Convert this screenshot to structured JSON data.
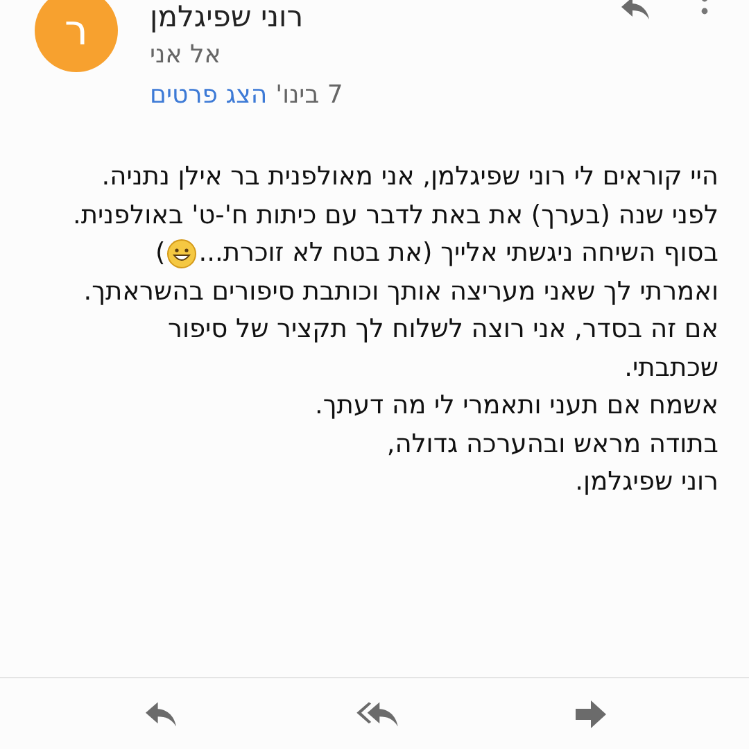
{
  "sender": {
    "avatar_letter": "ר",
    "name": "רוני שפיגלמן",
    "to": "אל אני",
    "date": "7 בינו'",
    "details_link": "הצג פרטים"
  },
  "body": [
    {
      "text": "היי קוראים לי רוני שפיגלמן, אני מאולפנית בר אילן נתניה."
    },
    {
      "text": "לפני שנה (בערך) את באת לדבר עם כיתות ח'-ט' באולפנית."
    },
    {
      "text": "בסוף השיחה ניגשתי אלייך (את בטח לא זוכרת...",
      "emoji": true,
      "tail": ")"
    },
    {
      "text": "ואמרתי לך שאני מעריצה אותך וכותבת סיפורים בהשראתך."
    },
    {
      "text": "אם זה בסדר, אני רוצה לשלוח לך תקציר של סיפור"
    },
    {
      "text": "שכתבתי."
    },
    {
      "text": "אשמח אם תעני ותאמרי לי מה דעתך."
    },
    {
      "text": "בתודה מראש ובהערכה גדולה,"
    },
    {
      "text": "רוני שפיגלמן."
    }
  ]
}
